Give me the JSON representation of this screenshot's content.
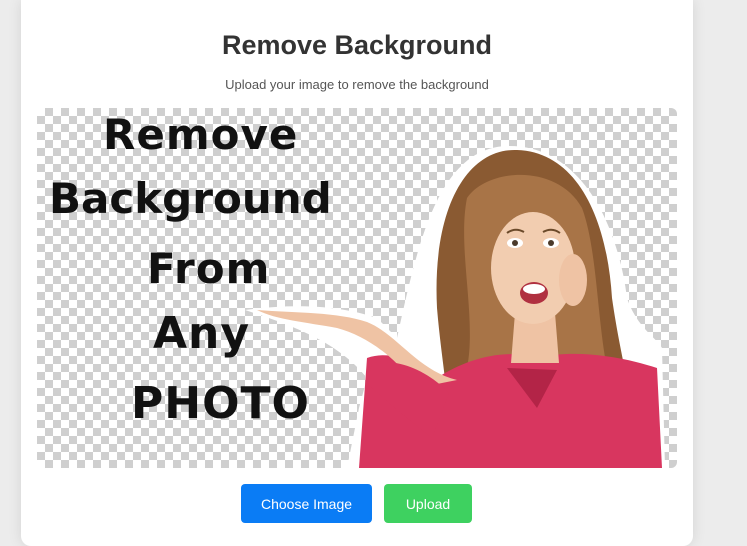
{
  "page": {
    "title": "Remove Background",
    "subtitle": "Upload your image to remove the background"
  },
  "preview": {
    "banner_lines": [
      "Remove",
      "Background",
      "From",
      "Any",
      "PHOTO"
    ]
  },
  "actions": {
    "choose_label": "Choose Image",
    "upload_label": "Upload"
  },
  "colors": {
    "choose_button": "#0a7cf5",
    "upload_button": "#3ed160",
    "title_text": "#333333",
    "shirt": "#d8365f",
    "hair": "#8a5a32"
  }
}
